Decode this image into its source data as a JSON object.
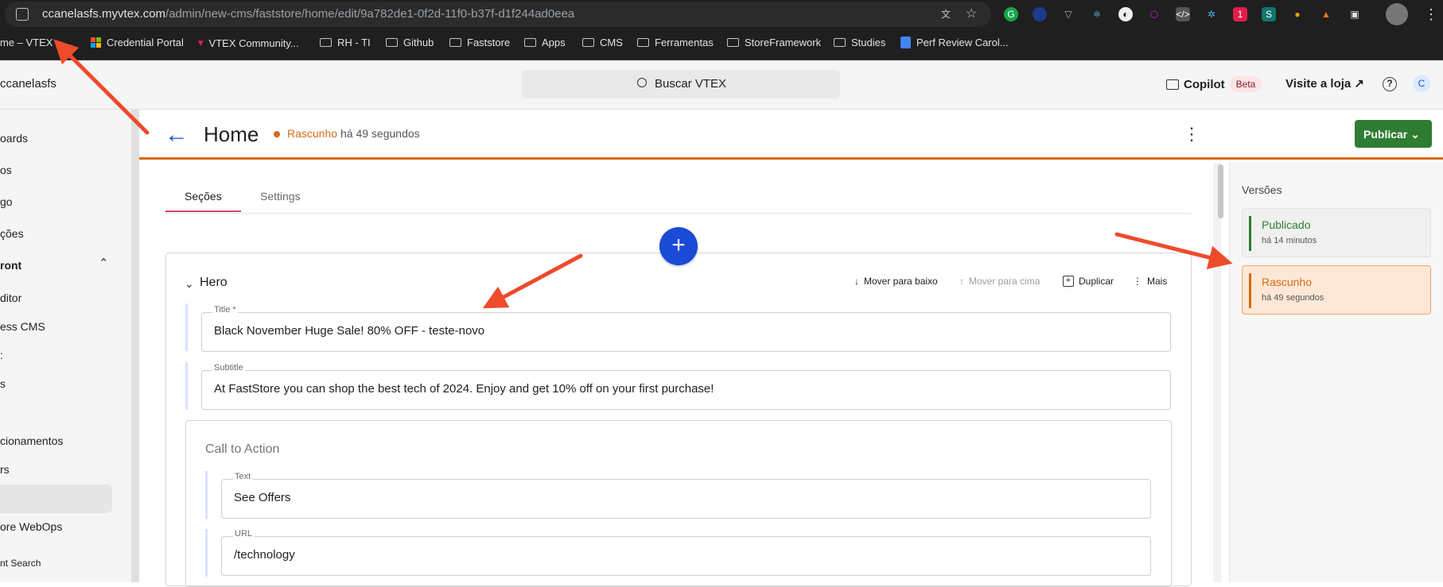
{
  "browser": {
    "url_host": "ccanelasfs.myvtex.com",
    "url_path": "/admin/new-cms/faststore/home/edit/9a782de1-0f2d-11f0-b37f-d1f244ad0eea",
    "bookmarks": [
      "me – VTEX – ...",
      "Credential Portal",
      "VTEX Community...",
      "RH - TI",
      "Github",
      "Faststore",
      "Apps",
      "CMS",
      "Ferramentas",
      "StoreFramework",
      "Studies",
      "Perf Review Carol..."
    ]
  },
  "header": {
    "account": "ccanelasfs",
    "search_placeholder": "Buscar VTEX",
    "copilot": "Copilot",
    "beta": "Beta",
    "visit_store": "Visite a loja ↗",
    "avatar_initial": "C"
  },
  "sidebar": {
    "items": [
      "oards",
      "os",
      "go",
      "ções",
      "ront",
      "ditor",
      "ess CMS",
      ":",
      "s",
      "cionamentos",
      "rs",
      "ore WebOps",
      "nt Search"
    ]
  },
  "page": {
    "title": "Home",
    "status_label": "Rascunho",
    "status_time": "há 49 segundos",
    "publish_label": "Publicar"
  },
  "tabs": {
    "sections": "Seções",
    "settings": "Settings"
  },
  "hero": {
    "label": "Hero",
    "actions": {
      "move_down": "Mover para baixo",
      "move_up": "Mover para cima",
      "duplicate": "Duplicar",
      "more": "Mais"
    },
    "title_label": "Title *",
    "title_value": "Black November Huge Sale! 80% OFF - teste-novo",
    "subtitle_label": "Subtitle",
    "subtitle_value": "At FastStore you can shop the best tech of 2024. Enjoy and get 10% off on your first purchase!",
    "cta_label": "Call to Action",
    "cta_text_label": "Text",
    "cta_text_value": "See Offers",
    "cta_url_label": "URL",
    "cta_url_value": "/technology"
  },
  "versions": {
    "title": "Versões",
    "published": {
      "label": "Publicado",
      "time": "há 14 minutos"
    },
    "draft": {
      "label": "Rascunho",
      "time": "há 49 segundos"
    }
  },
  "colors": {
    "accent_blue": "#1a4ad6",
    "draft_orange": "#d86a14",
    "publish_green": "#2e7d32",
    "annotation_red": "#ee4b2b"
  }
}
